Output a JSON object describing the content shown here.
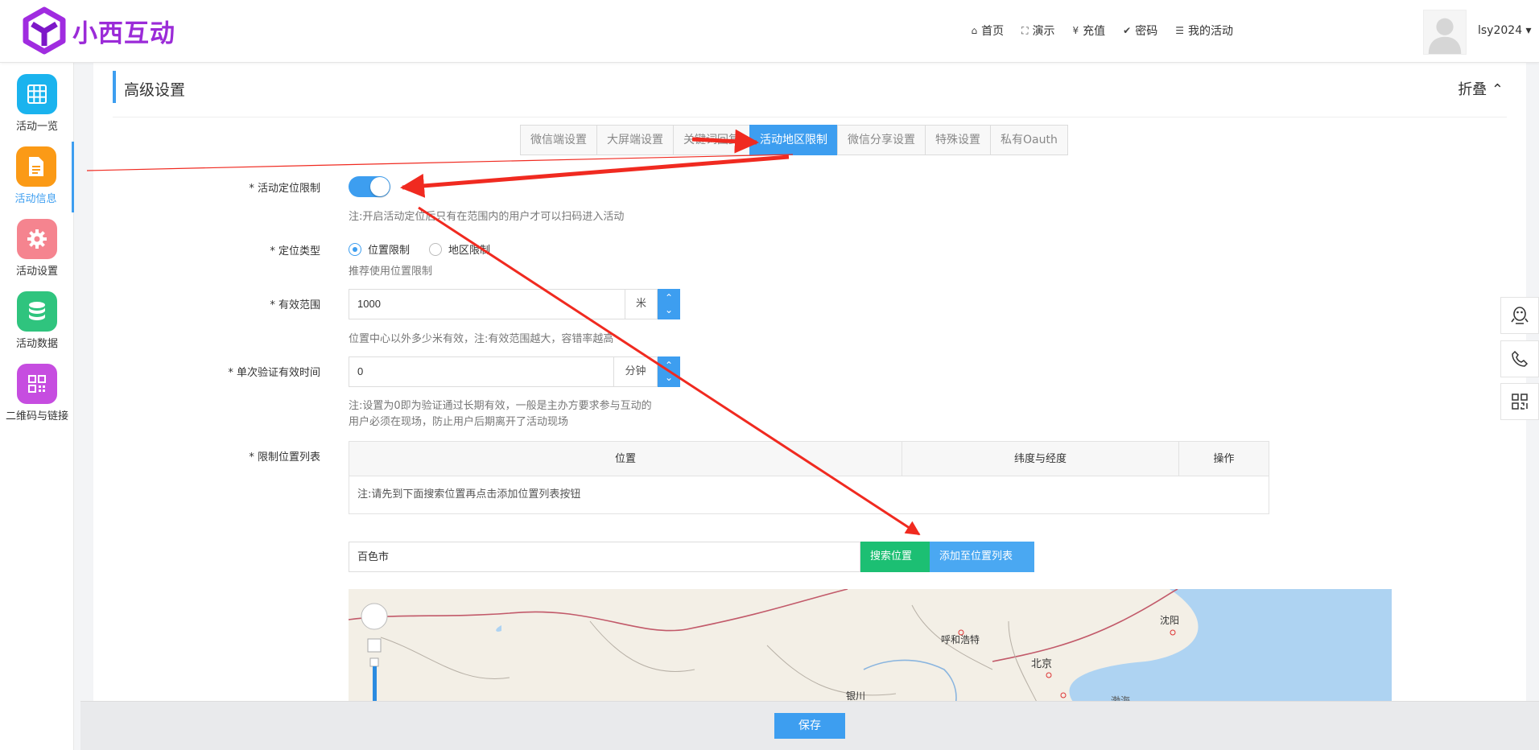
{
  "header": {
    "logo_text": "小西互动",
    "nav": [
      {
        "icon": "home-icon",
        "glyph": "⌂",
        "label": "首页"
      },
      {
        "icon": "fullscreen-icon",
        "glyph": "⛶",
        "label": "演示"
      },
      {
        "icon": "yen-icon",
        "glyph": "¥",
        "label": "充值"
      },
      {
        "icon": "check-circle-icon",
        "glyph": "✔",
        "label": "密码"
      },
      {
        "icon": "list-icon",
        "glyph": "☰",
        "label": "我的活动"
      }
    ],
    "user": "lsy2024 ▾"
  },
  "sidebar": {
    "items": [
      {
        "label": "活动一览",
        "color": "#1ab3ee",
        "icon": "grid-icon"
      },
      {
        "label": "活动信息",
        "color": "#fb9a16",
        "icon": "document-icon"
      },
      {
        "label": "活动设置",
        "color": "#f5848f",
        "icon": "gear-icon"
      },
      {
        "label": "活动数据",
        "color": "#2fc47e",
        "icon": "database-icon"
      },
      {
        "label": "二维码与链接",
        "color": "#c64de0",
        "icon": "qrcode-icon"
      }
    ]
  },
  "section": {
    "title": "高级设置",
    "fold_label": "折叠 ⌃"
  },
  "tabs": [
    "微信端设置",
    "大屏端设置",
    "关键词回复",
    "活动地区限制",
    "微信分享设置",
    "特殊设置",
    "私有Oauth"
  ],
  "form": {
    "locate_limit_label": "* 活动定位限制",
    "locate_limit_hint": "注:开启活动定位后只有在范围内的用户才可以扫码进入活动",
    "locate_type_label": "* 定位类型",
    "radio_position": "位置限制",
    "radio_region": "地区限制",
    "locate_type_hint": "推荐使用位置限制",
    "range_label": "* 有效范围",
    "range_value": "1000",
    "range_unit": "米",
    "range_hint": "位置中心以外多少米有效，注:有效范围越大，容错率越高",
    "verify_label": "* 单次验证有效时间",
    "verify_value": "0",
    "verify_unit": "分钟",
    "verify_hint_1": "注:设置为0即为验证通过长期有效，一般是主办方要求参与互动的",
    "verify_hint_2": "用户必须在现场，防止用户后期离开了活动现场",
    "list_label": "* 限制位置列表",
    "table_headers": [
      "位置",
      "纬度与经度",
      "操作"
    ],
    "table_empty": "注:请先到下面搜索位置再点击添加位置列表按钮",
    "search_value": "百色市",
    "search_button": "搜索位置",
    "add_button": "添加至位置列表"
  },
  "map": {
    "cities": [
      "呼和浩特",
      "北京",
      "沈阳",
      "银川",
      "渤海"
    ]
  },
  "footer": {
    "save": "保存"
  },
  "floating": [
    "qq-icon",
    "phone-icon",
    "qrcode-small-icon"
  ],
  "colors": {
    "accent": "#3d9ef0",
    "green": "#1cbf73",
    "logo": "#9b2bd8",
    "arrow": "#f02a20"
  }
}
